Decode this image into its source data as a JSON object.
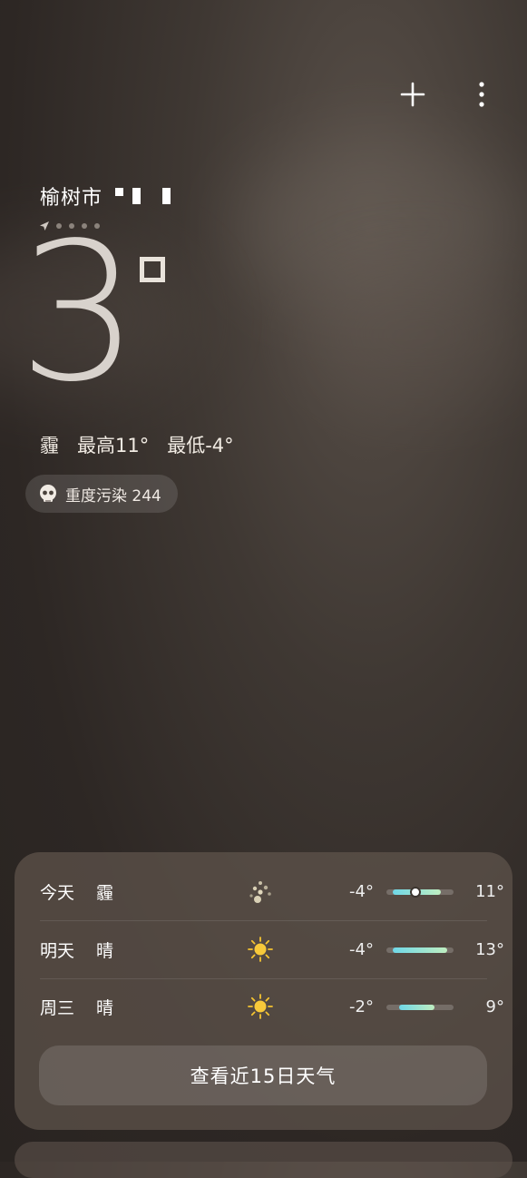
{
  "header": {
    "add_icon": "plus-icon",
    "more_icon": "more-vertical-icon"
  },
  "location": {
    "city": "榆树市",
    "page_count": 5,
    "current_page": 1
  },
  "current": {
    "temperature": "3",
    "condition": "霾",
    "high": "最高11°",
    "low": "最低-4°"
  },
  "aqi": {
    "icon": "skull-icon",
    "label": "重度污染 244"
  },
  "forecast": {
    "rows": [
      {
        "day": "今天",
        "cond": "霾",
        "icon": "haze-icon",
        "low": "-4°",
        "high": "11°",
        "low_val": -4,
        "high_val": 11,
        "now_val": 3
      },
      {
        "day": "明天",
        "cond": "晴",
        "icon": "sun-icon",
        "low": "-4°",
        "high": "13°",
        "low_val": -4,
        "high_val": 13
      },
      {
        "day": "周三",
        "cond": "晴",
        "icon": "sun-icon",
        "low": "-2°",
        "high": "9°",
        "low_val": -2,
        "high_val": 9
      }
    ],
    "button": "查看近15日天气"
  },
  "colors": {
    "bar_start": "#6fd8e8",
    "bar_end": "#bfeec0",
    "sun": "#f5c431"
  }
}
